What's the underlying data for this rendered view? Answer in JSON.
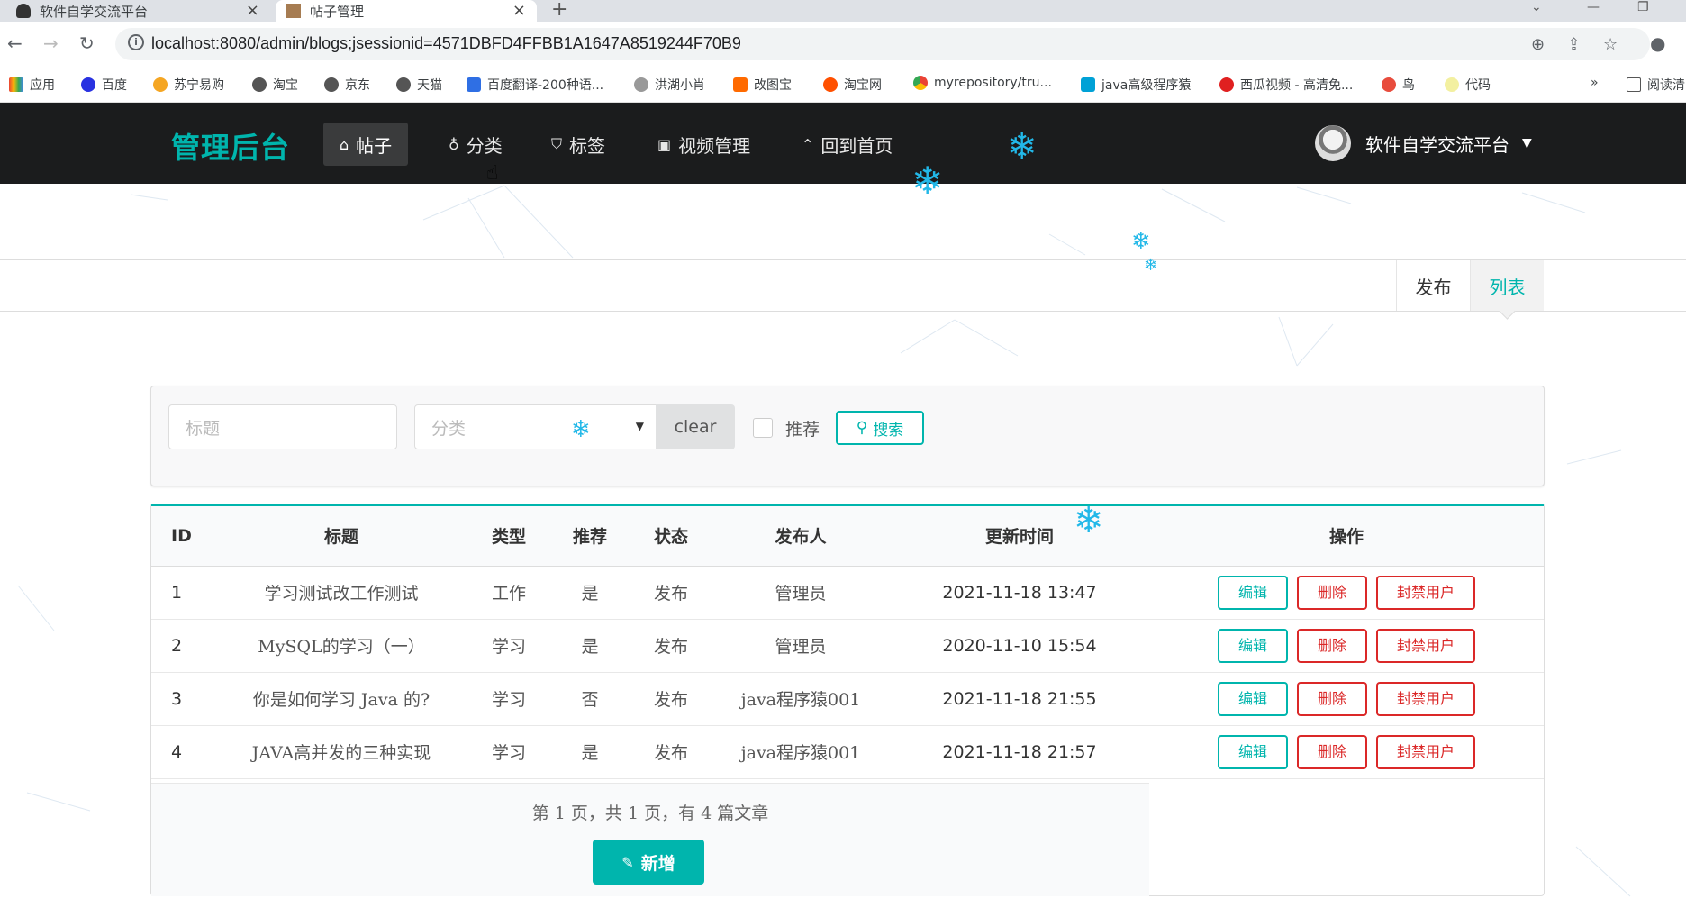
{
  "browser": {
    "tabs": [
      {
        "title": "软件自学交流平台"
      },
      {
        "title": "帖子管理"
      }
    ],
    "url": "localhost:8080/admin/blogs;jsessionid=4571DBFD4FFBB1A1647A8519244F70B9",
    "bookmarks": [
      "应用",
      "百度",
      "苏宁易购",
      "淘宝",
      "京东",
      "天猫",
      "百度翻译-200种语...",
      "洪湖小肖",
      "改图宝",
      "淘宝网",
      "myrepository/tru...",
      "java高级程序猿",
      "西瓜视频 - 高清免...",
      "鸟",
      "代码",
      "阅读清"
    ],
    "more": "»"
  },
  "nav": {
    "brand": "管理后台",
    "items": [
      "帖子",
      "分类",
      "标签",
      "视频管理",
      "回到首页"
    ],
    "user": "软件自学交流平台"
  },
  "submenu": {
    "publish": "发布",
    "list": "列表"
  },
  "search": {
    "title_placeholder": "标题",
    "category_placeholder": "分类",
    "clear": "clear",
    "recommend": "推荐",
    "search_btn": "搜索"
  },
  "table": {
    "headers": [
      "ID",
      "标题",
      "类型",
      "推荐",
      "状态",
      "发布人",
      "更新时间",
      "操作"
    ],
    "rows": [
      {
        "id": "1",
        "title": "学习测试改工作测试",
        "type": "工作",
        "recommend": "是",
        "status": "发布",
        "author": "管理员",
        "updated": "2021-11-18 13:47"
      },
      {
        "id": "2",
        "title": "MySQL的学习（一）",
        "type": "学习",
        "recommend": "是",
        "status": "发布",
        "author": "管理员",
        "updated": "2020-11-10 15:54"
      },
      {
        "id": "3",
        "title": "你是如何学习 Java 的?",
        "type": "学习",
        "recommend": "否",
        "status": "发布",
        "author": "java程序猿001",
        "updated": "2021-11-18 21:55"
      },
      {
        "id": "4",
        "title": "JAVA高并发的三种实现",
        "type": "学习",
        "recommend": "是",
        "status": "发布",
        "author": "java程序猿001",
        "updated": "2021-11-18 21:57"
      }
    ],
    "actions": {
      "edit": "编辑",
      "delete": "删除",
      "ban": "封禁用户"
    },
    "page_info": "第 1 页，共 1 页，有 4 篇文章",
    "add_btn": "新增"
  },
  "colors": {
    "teal": "#00b5ad",
    "red": "#db2828",
    "nav_bg": "#1b1c1d"
  }
}
